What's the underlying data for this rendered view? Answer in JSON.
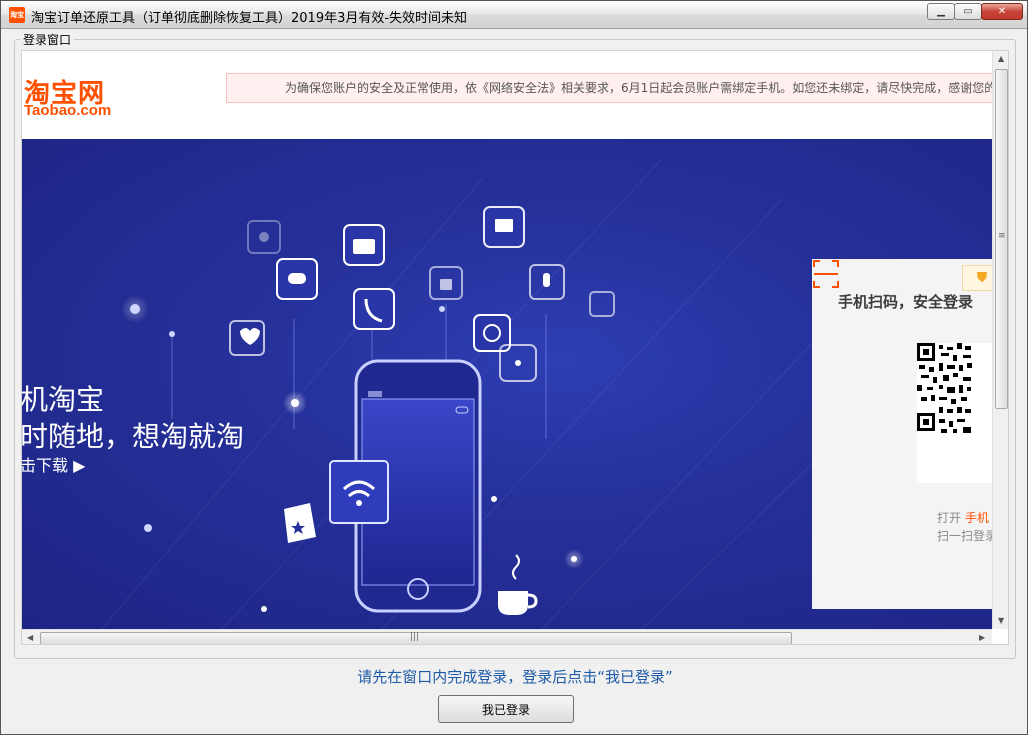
{
  "window": {
    "title": "淘宝订单还原工具（订单彻底删除恢复工具）2019年3月有效-失效时间未知",
    "icon_text": "淘宝",
    "buttons": [
      "minimize-icon",
      "maximize-icon",
      "close-icon"
    ]
  },
  "group": {
    "label": "登录窗口"
  },
  "browser": {
    "logo_cn": "淘宝网",
    "logo_en": "Taobao.com",
    "notice": "为确保您账户的安全及正常使用，依《网络安全法》相关要求，6月1日起会员账户需绑定手机。如您还未绑定，请尽快完成，感谢您的",
    "banner": {
      "slogan_line1": "机淘宝",
      "slogan_line2": "时随地，想淘就淘",
      "download": "击下载 ▶"
    },
    "login_panel": {
      "title": "手机扫码，安全登录",
      "scan_line1_prefix": "打开",
      "scan_line1_highlight": "手机",
      "scan_line2": "扫一扫登录"
    }
  },
  "footer": {
    "hint": "请先在窗口内完成登录，登录后点击“我已登录”",
    "done_button": "我已登录"
  },
  "colors": {
    "brand": "#ff5000",
    "banner": "#25309a",
    "hint": "#1e5aa6"
  }
}
